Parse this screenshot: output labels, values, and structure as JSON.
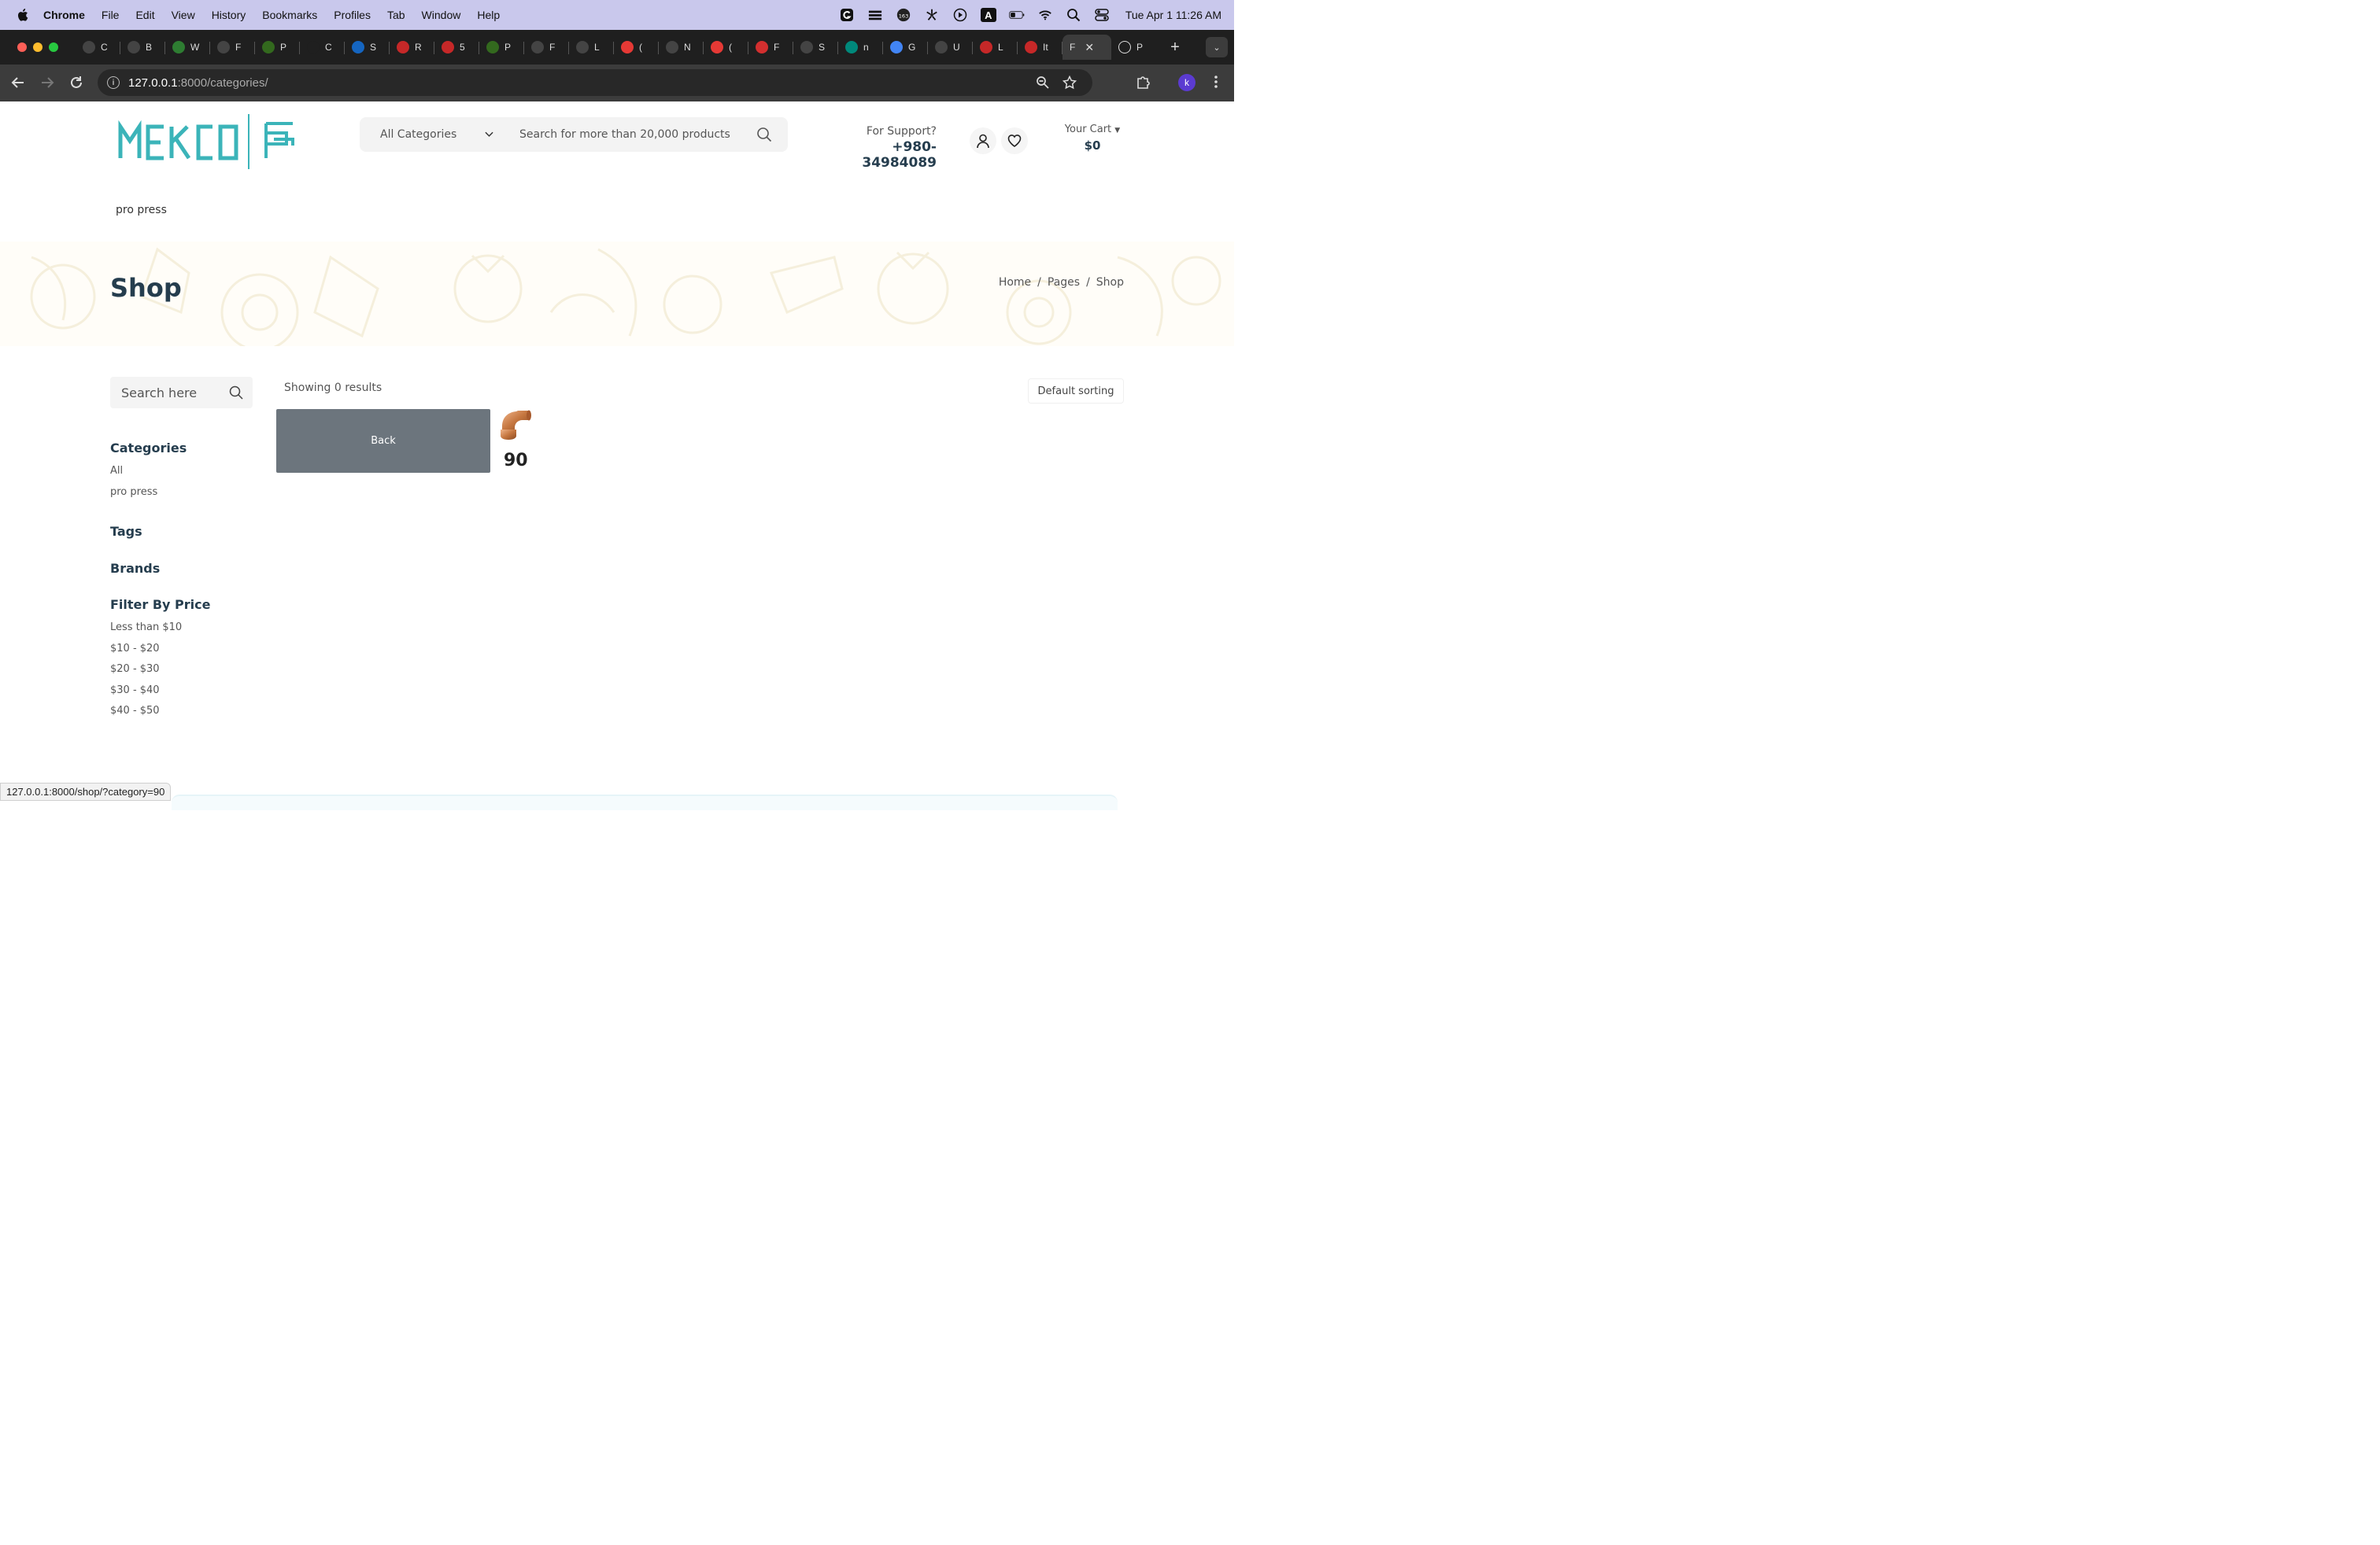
{
  "menubar": {
    "app": "Chrome",
    "items": [
      "File",
      "Edit",
      "View",
      "History",
      "Bookmarks",
      "Profiles",
      "Tab",
      "Window",
      "Help"
    ],
    "badge": "163",
    "text_icon": "A",
    "clock": "Tue Apr 1  11:26 AM"
  },
  "tabs": [
    {
      "letter": "C",
      "icon": "openai-icon",
      "color": "#444"
    },
    {
      "letter": "B",
      "icon": "globe-icon",
      "color": "#444"
    },
    {
      "letter": "W",
      "icon": "w-icon",
      "color": "#2e7d32"
    },
    {
      "letter": "F",
      "icon": "globe-icon",
      "color": "#444"
    },
    {
      "letter": "P",
      "icon": "green-circle-icon",
      "color": "#33691e"
    },
    {
      "letter": "C",
      "icon": "blank-icon",
      "color": "#1f1f1f"
    },
    {
      "letter": "S",
      "icon": "p-icon",
      "color": "#1565c0"
    },
    {
      "letter": "R",
      "icon": "gmail-icon",
      "color": "#c62828"
    },
    {
      "letter": "5",
      "icon": "gmail-icon",
      "color": "#c62828"
    },
    {
      "letter": "P",
      "icon": "green-circle-icon",
      "color": "#33691e"
    },
    {
      "letter": "F",
      "icon": "globe-icon",
      "color": "#444"
    },
    {
      "letter": "L",
      "icon": "openai-icon",
      "color": "#444"
    },
    {
      "letter": "(",
      "icon": "youtube-icon",
      "color": "#e53935"
    },
    {
      "letter": "N",
      "icon": "globe-icon",
      "color": "#444"
    },
    {
      "letter": "(",
      "icon": "youtube-icon",
      "color": "#e53935"
    },
    {
      "letter": "F",
      "icon": "download-icon",
      "color": "#d32f2f"
    },
    {
      "letter": "S",
      "icon": "openai-icon",
      "color": "#444"
    },
    {
      "letter": "n",
      "icon": "teal-icon",
      "color": "#00897b"
    },
    {
      "letter": "G",
      "icon": "google-icon",
      "color": "#4285f4"
    },
    {
      "letter": "U",
      "icon": "globe-icon",
      "color": "#444"
    },
    {
      "letter": "L",
      "icon": "flame-icon",
      "color": "#c62828"
    },
    {
      "letter": "It",
      "icon": "flame-icon",
      "color": "#c62828"
    }
  ],
  "active_tab": {
    "letter": "F",
    "close": "✕"
  },
  "last_tab": {
    "letter": "P",
    "icon": "leaf-icon"
  },
  "new_tab": "+",
  "address": {
    "host": "127.0.0.1",
    "path": ":8000/categories/"
  },
  "profile_initial": "k",
  "header": {
    "category_select": "All Categories",
    "search_placeholder": "Search for more than 20,000 products",
    "support_label": "For Support?",
    "support_phone": "+980-34984089",
    "cart_label": "Your Cart",
    "cart_amount": "$0",
    "nav_category": "pro press"
  },
  "page": {
    "title": "Shop",
    "breadcrumb": [
      "Home",
      "/",
      "Pages",
      "/",
      "Shop"
    ]
  },
  "sidebar": {
    "search_placeholder": "Search here",
    "categories_heading": "Categories",
    "categories": [
      "All",
      "pro press"
    ],
    "tags_heading": "Tags",
    "brands_heading": "Brands",
    "price_heading": "Filter By Price",
    "prices": [
      "Less than $10",
      "$10 - $20",
      "$20 - $30",
      "$30 - $40",
      "$40 - $50"
    ]
  },
  "main": {
    "results": "Showing 0 results",
    "sorting": "Default sorting",
    "back_label": "Back",
    "product_name": "90"
  },
  "status_url": "127.0.0.1:8000/shop/?category=90",
  "colors": {
    "accent": "#3bb4b9",
    "button": "#6c757d",
    "heading": "#253d4e"
  }
}
